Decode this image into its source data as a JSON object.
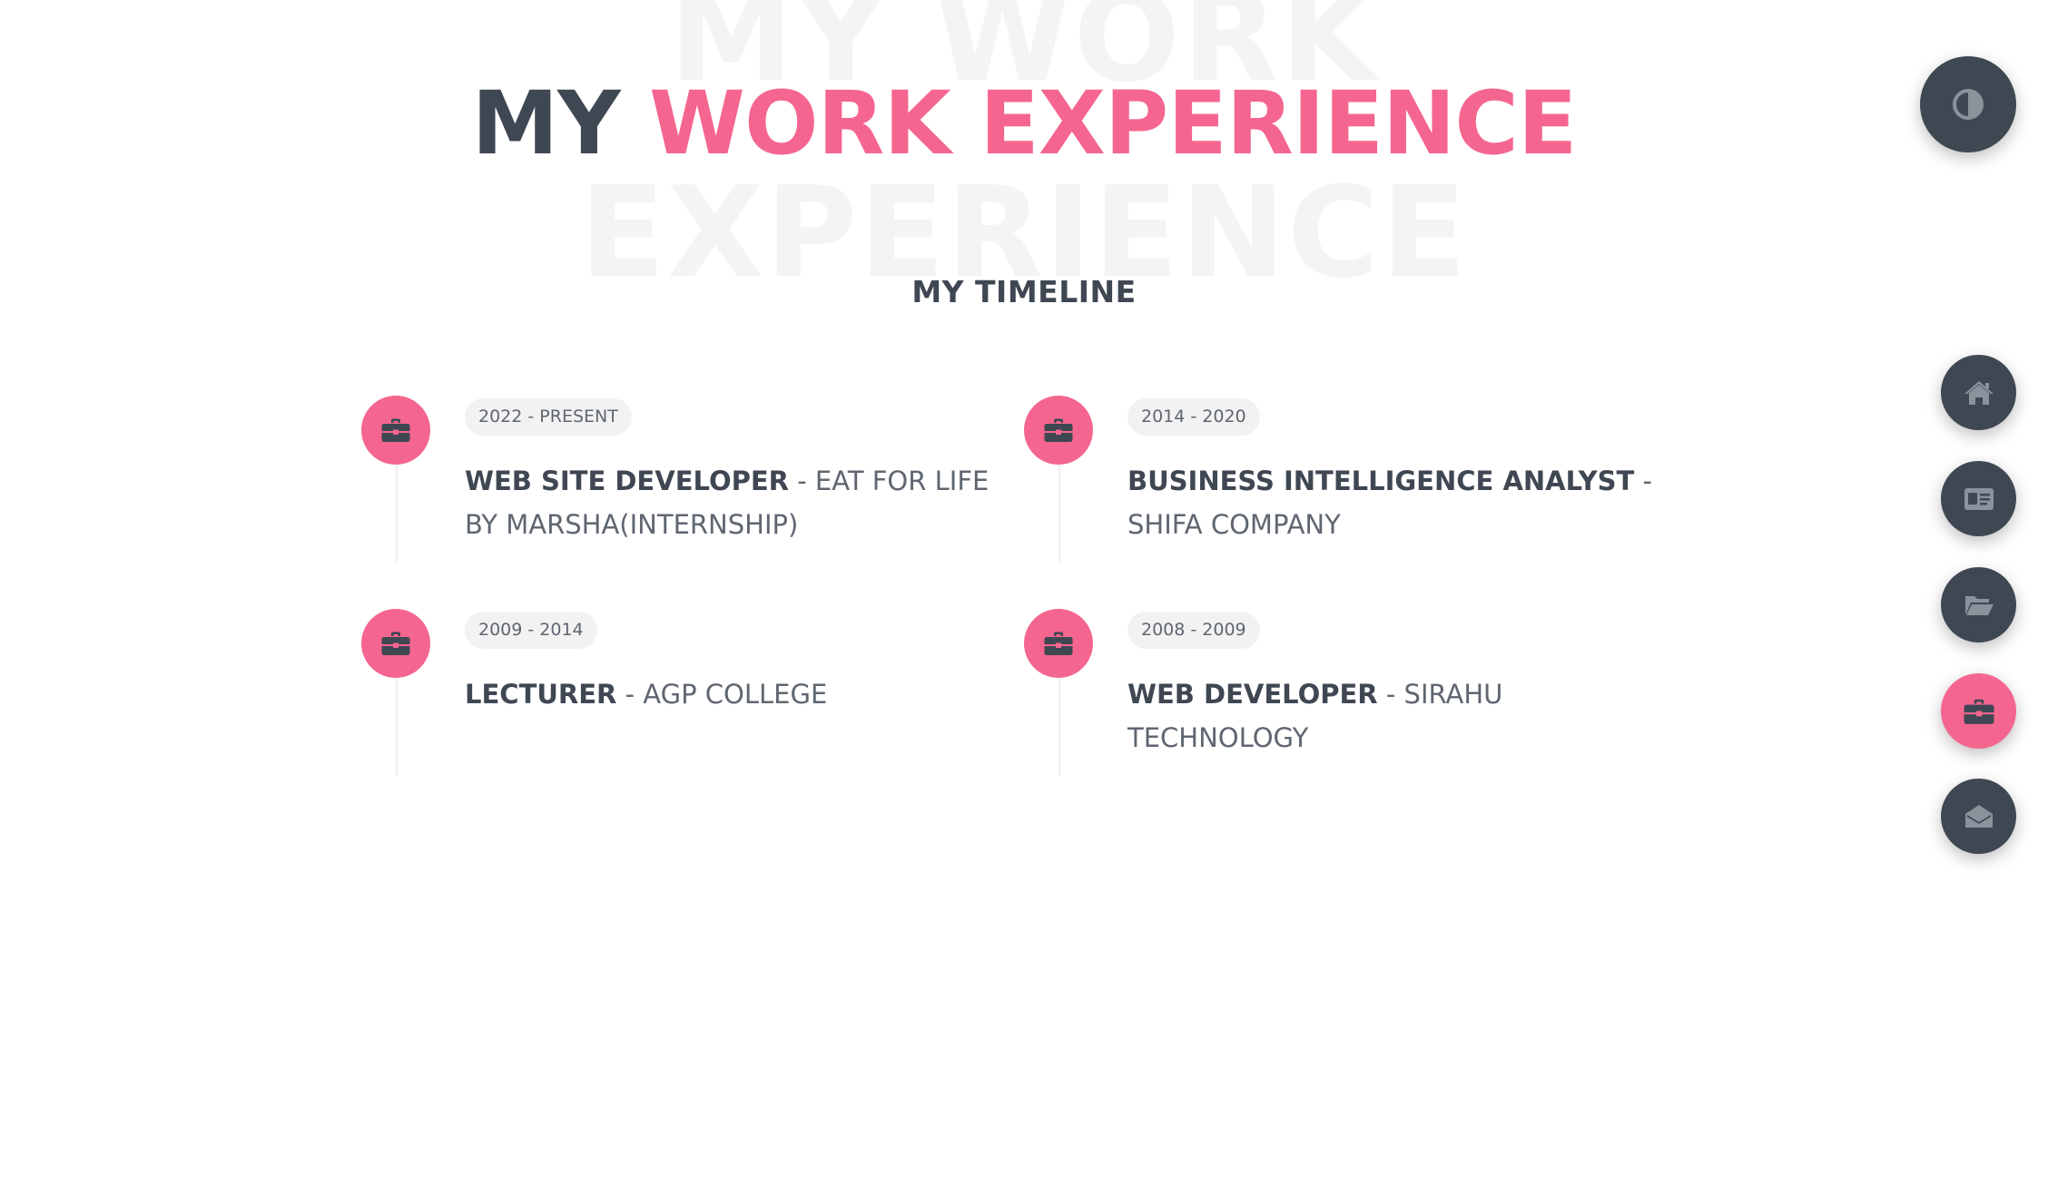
{
  "heading": {
    "watermark_line1": "MY WORK",
    "watermark_line2": "EXPERIENCE",
    "title_prefix": "MY",
    "title_accent": "WORK EXPERIENCE",
    "subtitle": "MY TIMELINE"
  },
  "timeline": [
    {
      "period": "2022 - PRESENT",
      "role": "WEB SITE DEVELOPER",
      "separator": " - ",
      "company": "EAT FOR LIFE BY MARSHA(INTERNSHIP)",
      "icon": "briefcase-icon"
    },
    {
      "period": "2014 - 2020",
      "role": "BUSINESS INTELLIGENCE ANALYST",
      "separator": " - ",
      "company": "SHIFA COMPANY",
      "icon": "briefcase-icon"
    },
    {
      "period": "2009 - 2014",
      "role": "LECTURER",
      "separator": " - ",
      "company": "AGP COLLEGE",
      "icon": "briefcase-icon"
    },
    {
      "period": "2008 - 2009",
      "role": "WEB DEVELOPER",
      "separator": " - ",
      "company": "SIRAHU TECHNOLOGY",
      "icon": "briefcase-icon"
    }
  ],
  "nav": {
    "theme_toggle_icon": "half-circle-contrast-icon",
    "items": [
      {
        "icon": "home-icon",
        "active": false
      },
      {
        "icon": "id-card-icon",
        "active": false
      },
      {
        "icon": "folder-open-icon",
        "active": false
      },
      {
        "icon": "briefcase-icon",
        "active": true
      },
      {
        "icon": "envelope-open-icon",
        "active": false
      }
    ]
  },
  "colors": {
    "accent": "#f4668f",
    "dark": "#3f4753",
    "muted_text": "#5f6670",
    "watermark": "#f4f4f4",
    "nav_icon": "#8a929c"
  }
}
